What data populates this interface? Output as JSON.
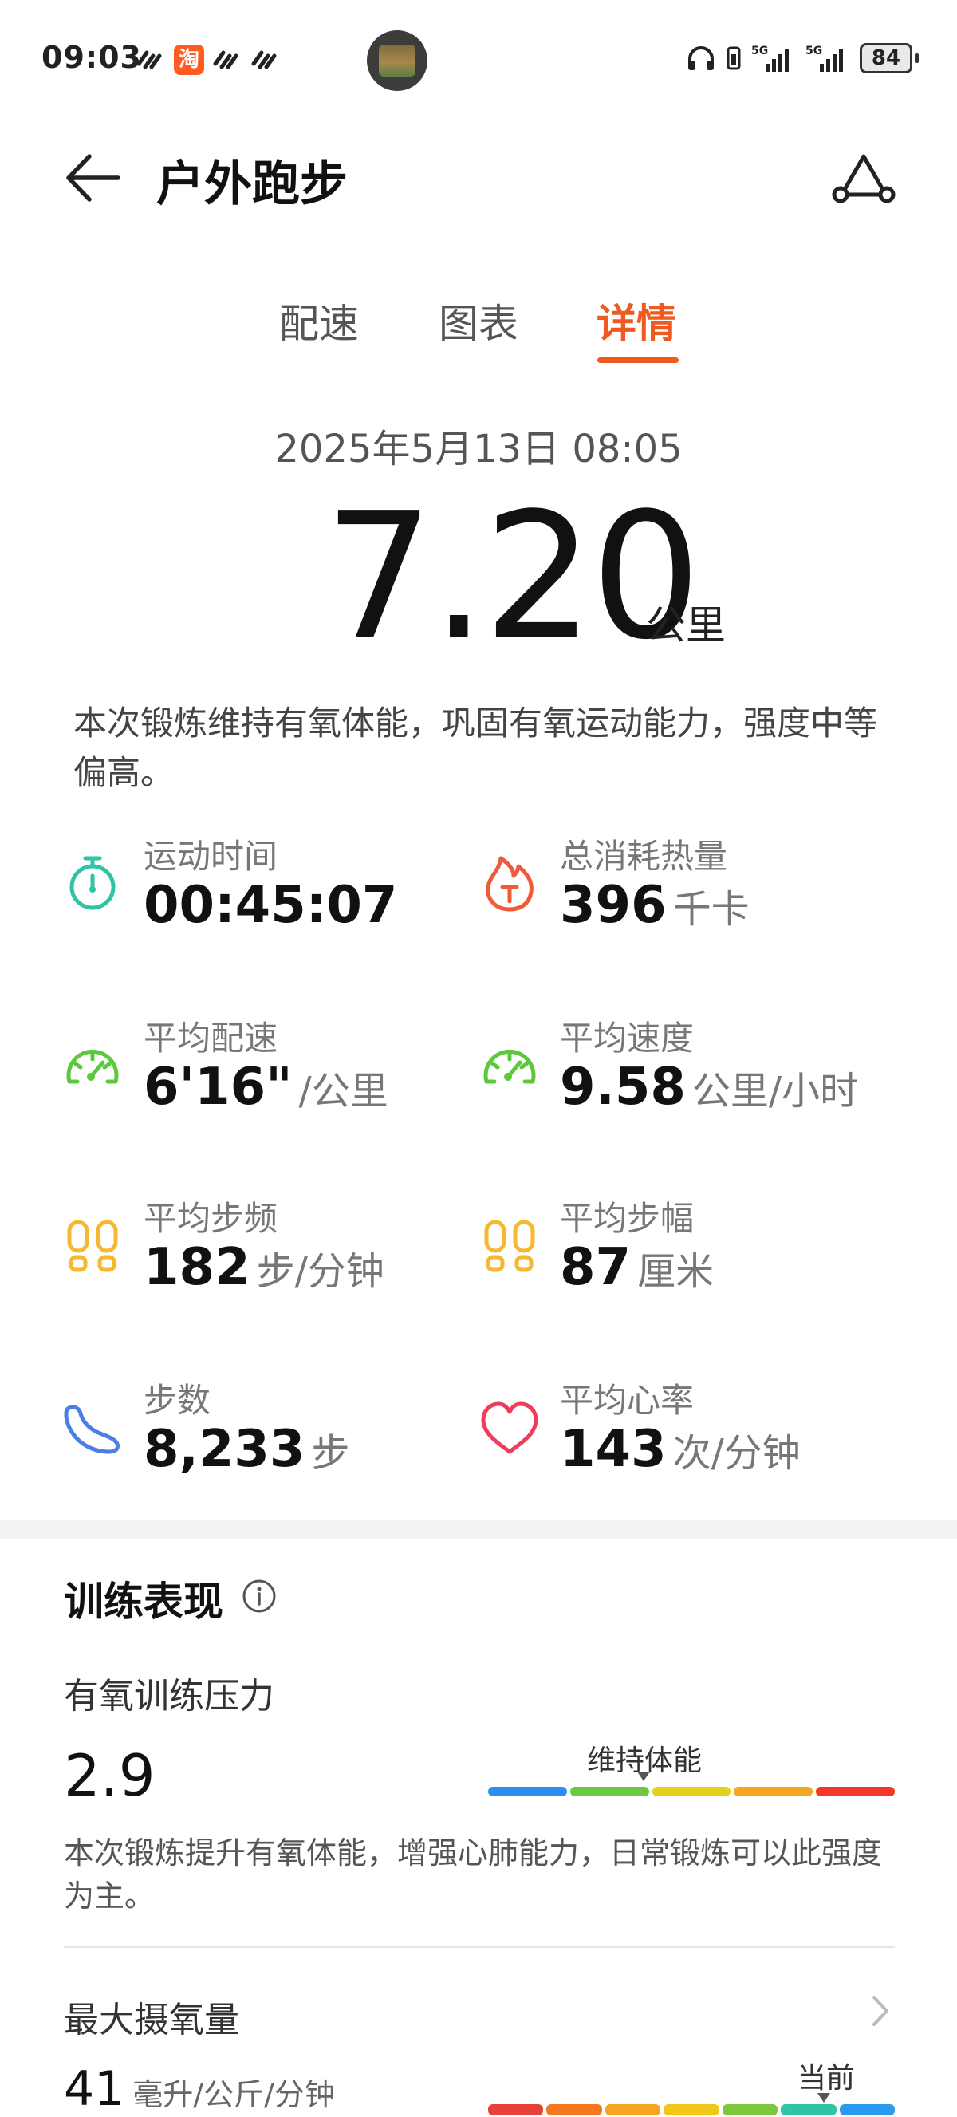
{
  "status_bar": {
    "time": "09:03",
    "app_badge": "淘",
    "battery": "84"
  },
  "header": {
    "title": "户外跑步"
  },
  "tabs": [
    {
      "label": "配速",
      "active": false
    },
    {
      "label": "图表",
      "active": false
    },
    {
      "label": "详情",
      "active": true
    }
  ],
  "summary": {
    "datetime": "2025年5月13日 08:05",
    "distance": "7.20",
    "distance_unit": "公里",
    "description": "本次锻炼维持有氧体能，巩固有氧运动能力，强度中等偏高。"
  },
  "metrics": [
    {
      "label": "运动时间",
      "value": "00:45:07",
      "unit": "",
      "icon": "stopwatch-icon",
      "color": "#2ec4a4"
    },
    {
      "label": "总消耗热量",
      "value": "396",
      "unit": "千卡",
      "icon": "flame-icon",
      "color": "#ee5a3a"
    },
    {
      "label": "平均配速",
      "value": "6'16\"",
      "unit": "/公里",
      "icon": "speedometer-icon",
      "color": "#5cc83c"
    },
    {
      "label": "平均速度",
      "value": "9.58",
      "unit": "公里/小时",
      "icon": "speedometer-icon",
      "color": "#5cc83c"
    },
    {
      "label": "平均步频",
      "value": "182",
      "unit": "步/分钟",
      "icon": "footprints-icon",
      "color": "#f5b82e"
    },
    {
      "label": "平均步幅",
      "value": "87",
      "unit": "厘米",
      "icon": "footprints-icon",
      "color": "#f5b82e"
    },
    {
      "label": "步数",
      "value": "8,233",
      "unit": "步",
      "icon": "shoe-icon",
      "color": "#4a7fe8"
    },
    {
      "label": "平均心率",
      "value": "143",
      "unit": "次/分钟",
      "icon": "heart-icon",
      "color": "#ee3c5a"
    }
  ],
  "training": {
    "title": "训练表现",
    "aerobic": {
      "label": "有氧训练压力",
      "value": "2.9",
      "level": "维持体能",
      "description": "本次锻炼提升有氧体能，增强心肺能力，日常锻炼可以此强度为主。",
      "scale_colors": [
        "#2b8ef0",
        "#6cc93c",
        "#e2d21c",
        "#f5a623",
        "#f0392b"
      ]
    },
    "vo2max": {
      "label": "最大摄氧量",
      "value": "41",
      "unit": "毫升/公斤/分钟",
      "current_label": "当前",
      "scale_colors": [
        "#e8413a",
        "#f5781f",
        "#f5a623",
        "#f0c81c",
        "#7cc83c",
        "#2ec4a4",
        "#2b9bf0"
      ]
    }
  }
}
